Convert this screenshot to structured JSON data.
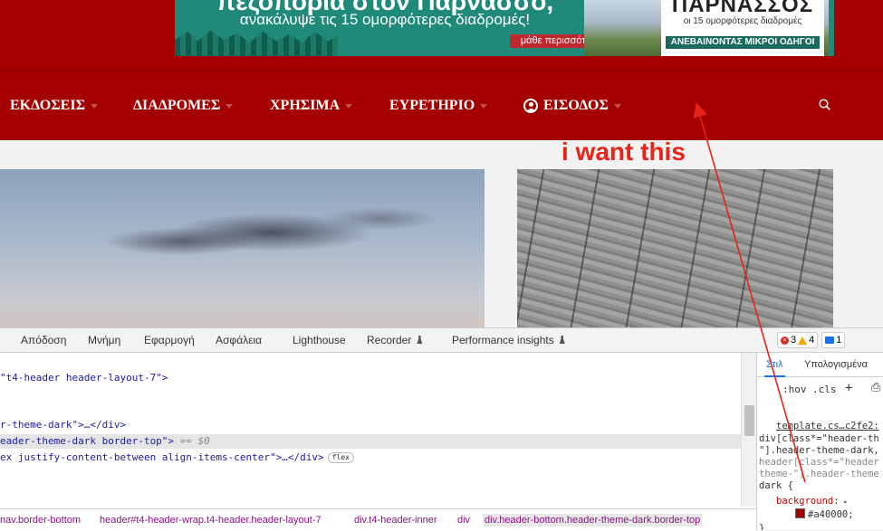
{
  "ad": {
    "headline": "πεζοπορία στον Παρνασσό,",
    "subhead": "ανακάλυψε τις 15 ομορφότερες διαδρομές!",
    "cta": "μάθε περισσότερα",
    "brand_title": "ΠΑΡΝΑΣΣΟΣ",
    "brand_sub": "οι 15 ομορφότερες διαδρομές",
    "brand_strip": "ΑΝΕΒΑΙΝΟΝΤΑΣ ΜΙΚΡΟΙ ΟΔΗΓΟΙ"
  },
  "nav": {
    "items": [
      {
        "label": "ΕΚΔΟΣΕΙΣ"
      },
      {
        "label": "ΔΙΑΔΡΟΜΕΣ"
      },
      {
        "label": "ΧΡΗΣΙΜΑ"
      },
      {
        "label": "ΕΥΡΕΤΗΡΙΟ"
      },
      {
        "label": "ΕΙΣΟΔΟΣ"
      }
    ]
  },
  "annotation": "i want this",
  "devtools": {
    "tabs": [
      "Απόδοση",
      "Μνήμη",
      "Εφαρμογή",
      "Ασφάλεια",
      "Lighthouse",
      "Recorder",
      "Performance insights"
    ],
    "badges": {
      "errors": "3",
      "warnings": "4",
      "messages": "1"
    },
    "elements": {
      "line1": "\"t4-header header-layout-7\">",
      "line2": "r-theme-dark\">…</div>",
      "line3": "eader-theme-dark border-top\">",
      "line3_eq": " == $0",
      "line4": "ex justify-content-between align-items-center\">…</div>",
      "flex_pill": "flex"
    },
    "breadcrumbs": [
      "nav.border-bottom",
      "header#t4-header-wrap.t4-header.header-layout-7",
      "div.t4-header-inner",
      "div",
      "div.header-bottom.header-theme-dark.border-top"
    ],
    "styles": {
      "tabs": [
        "Στιλ",
        "Υπολογισμένα"
      ],
      "filter_hov": ":hov",
      "filter_cls": ".cls",
      "source": "template.cs…c2fe2:",
      "rule_lines": [
        "div[class*=\"header-th",
        "\"].header-theme-dark,",
        "header[class*=\"header",
        "theme-\"].header-theme",
        "dark {"
      ],
      "property": "background:",
      "value": "#a40000;",
      "close": "}"
    }
  },
  "colors": {
    "header_bg": "#a40000",
    "annotation": "#e8231a",
    "accent_blue": "#1a73e8"
  }
}
